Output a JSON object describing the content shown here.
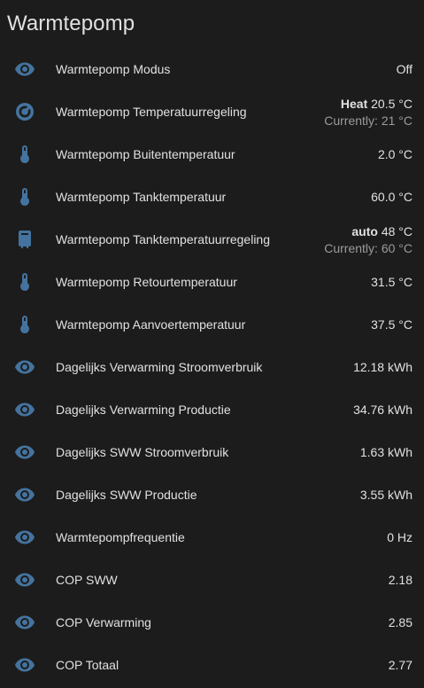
{
  "card": {
    "title": "Warmtepomp"
  },
  "colors": {
    "background": "#1c1c1c",
    "icon": "#44739e",
    "primary_text": "#e1e1e1",
    "secondary_text": "#9b9b9b"
  },
  "rows": [
    {
      "icon": "eye-icon",
      "name": "Warmtepomp Modus",
      "state": "Off"
    },
    {
      "icon": "thermostat-dial-icon",
      "name": "Warmtepomp Temperatuurregeling",
      "mode": "Heat",
      "target": "20.5 °C",
      "current": "Currently: 21 °C"
    },
    {
      "icon": "thermometer-icon",
      "name": "Warmtepomp Buitentemperatuur",
      "state": "2.0 °C"
    },
    {
      "icon": "thermometer-icon",
      "name": "Warmtepomp Tanktemperatuur",
      "state": "60.0 °C"
    },
    {
      "icon": "water-boiler-icon",
      "name": "Warmtepomp Tanktemperatuurregeling",
      "mode": "auto",
      "target": "48 °C",
      "current": "Currently: 60 °C"
    },
    {
      "icon": "thermometer-icon",
      "name": "Warmtepomp Retourtemperatuur",
      "state": "31.5 °C"
    },
    {
      "icon": "thermometer-icon",
      "name": "Warmtepomp Aanvoertemperatuur",
      "state": "37.5 °C"
    },
    {
      "icon": "eye-icon",
      "name": "Dagelijks Verwarming Stroomverbruik",
      "state": "12.18 kWh"
    },
    {
      "icon": "eye-icon",
      "name": "Dagelijks Verwarming Productie",
      "state": "34.76 kWh"
    },
    {
      "icon": "eye-icon",
      "name": "Dagelijks SWW Stroomverbruik",
      "state": "1.63 kWh"
    },
    {
      "icon": "eye-icon",
      "name": "Dagelijks SWW Productie",
      "state": "3.55 kWh"
    },
    {
      "icon": "eye-icon",
      "name": "Warmtepompfrequentie",
      "state": "0 Hz"
    },
    {
      "icon": "eye-icon",
      "name": "COP SWW",
      "state": "2.18"
    },
    {
      "icon": "eye-icon",
      "name": "COP Verwarming",
      "state": "2.85"
    },
    {
      "icon": "eye-icon",
      "name": "COP Totaal",
      "state": "2.77"
    }
  ]
}
